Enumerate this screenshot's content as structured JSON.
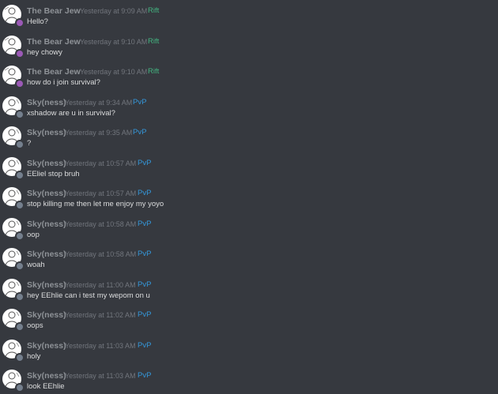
{
  "colors": {
    "background": "#36393f",
    "username": "#8e9297",
    "timestamp": "#72767d",
    "message_text": "#dcddde",
    "role_rift": "#43b581",
    "role_pvp": "#3498db",
    "status_purple": "#9b59b6",
    "status_gray": "#747f8d"
  },
  "messages": [
    {
      "author": "The Bear Jew",
      "timestamp": "Yesterday at 9:09 AM",
      "role": "Rift",
      "text": "Hello?",
      "avatar_icon": "avatar-sketch-icon",
      "status": "purple"
    },
    {
      "author": "The Bear Jew",
      "timestamp": "Yesterday at 9:10 AM",
      "role": "Rift",
      "text": "hey chowy",
      "avatar_icon": "avatar-sketch-icon",
      "status": "purple"
    },
    {
      "author": "The Bear Jew",
      "timestamp": "Yesterday at 9:10 AM",
      "role": "Rift",
      "text": "how do i join survival?",
      "avatar_icon": "avatar-sketch-icon",
      "status": "purple"
    },
    {
      "author": "Sky(ness)",
      "timestamp": "Yesterday at 9:34 AM",
      "role": "PvP",
      "text": "xshadow are u in survival?",
      "avatar_icon": "avatar-sketch-icon",
      "status": "gray"
    },
    {
      "author": "Sky(ness)",
      "timestamp": "Yesterday at 9:35 AM",
      "role": "PvP",
      "text": "?",
      "avatar_icon": "avatar-sketch-icon",
      "status": "gray"
    },
    {
      "author": "Sky(ness)",
      "timestamp": "Yesterday at 10:57 AM",
      "role": "PvP",
      "text": "EEliel stop bruh",
      "avatar_icon": "avatar-sketch-icon",
      "status": "gray"
    },
    {
      "author": "Sky(ness)",
      "timestamp": "Yesterday at 10:57 AM",
      "role": "PvP",
      "text": "stop killing me then let me enjoy my yoyo",
      "avatar_icon": "avatar-sketch-icon",
      "status": "gray"
    },
    {
      "author": "Sky(ness)",
      "timestamp": "Yesterday at 10:58 AM",
      "role": "PvP",
      "text": "oop",
      "avatar_icon": "avatar-sketch-icon",
      "status": "gray"
    },
    {
      "author": "Sky(ness)",
      "timestamp": "Yesterday at 10:58 AM",
      "role": "PvP",
      "text": "woah",
      "avatar_icon": "avatar-sketch-icon",
      "status": "gray"
    },
    {
      "author": "Sky(ness)",
      "timestamp": "Yesterday at 11:00 AM",
      "role": "PvP",
      "text": "hey EEhlie can i test my wepom on u",
      "avatar_icon": "avatar-sketch-icon",
      "status": "gray"
    },
    {
      "author": "Sky(ness)",
      "timestamp": "Yesterday at 11:02 AM",
      "role": "PvP",
      "text": "oops",
      "avatar_icon": "avatar-sketch-icon",
      "status": "gray"
    },
    {
      "author": "Sky(ness)",
      "timestamp": "Yesterday at 11:03 AM",
      "role": "PvP",
      "text": "holy",
      "avatar_icon": "avatar-sketch-icon",
      "status": "gray"
    },
    {
      "author": "Sky(ness)",
      "timestamp": "Yesterday at 11:03 AM",
      "role": "PvP",
      "text": "look EEhlie",
      "avatar_icon": "avatar-sketch-icon",
      "status": "gray"
    }
  ]
}
